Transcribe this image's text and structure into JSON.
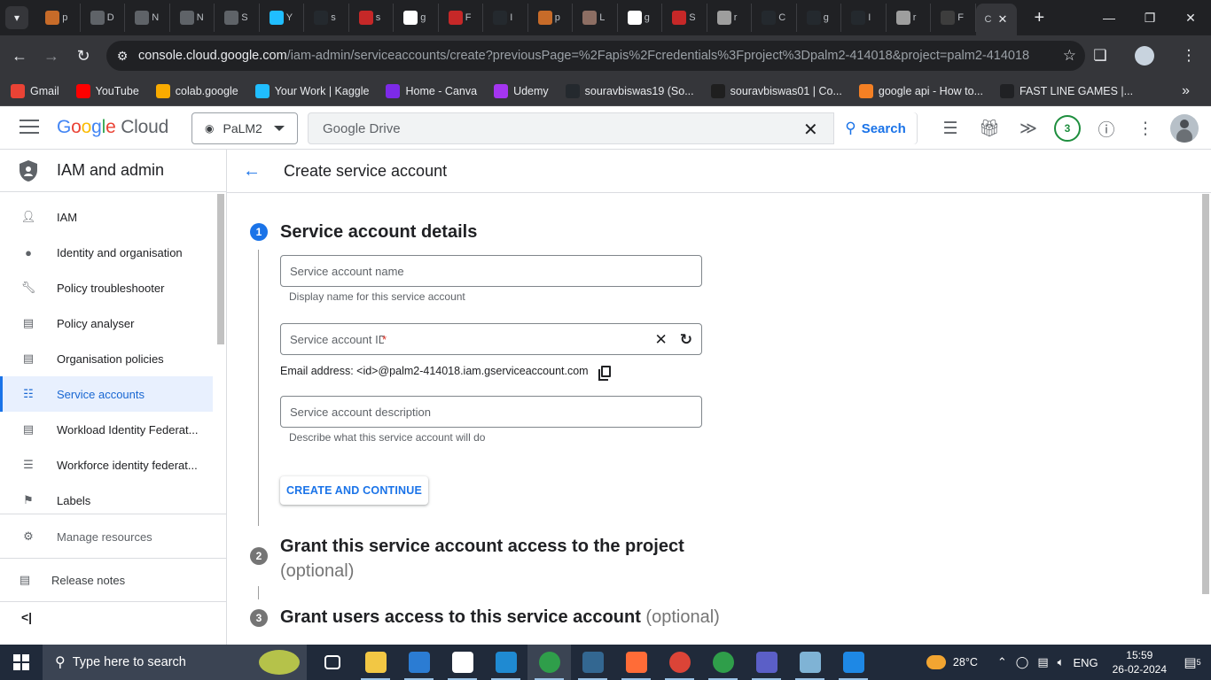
{
  "browser": {
    "tabs": [
      {
        "icon": "ai-icon",
        "label": "p",
        "color": "#c76b29"
      },
      {
        "icon": "doc-icon",
        "label": "D",
        "color": "#5f6368"
      },
      {
        "icon": "doc-icon",
        "label": "N",
        "color": "#5f6368"
      },
      {
        "icon": "doc-icon",
        "label": "N",
        "color": "#5f6368"
      },
      {
        "icon": "doc-icon",
        "label": "S",
        "color": "#5f6368"
      },
      {
        "icon": "kaggle-icon",
        "label": "Y",
        "color": "#20beff"
      },
      {
        "icon": "github-icon",
        "label": "s",
        "color": "#24292e"
      },
      {
        "icon": "crown-icon",
        "label": "s",
        "color": "#c62828"
      },
      {
        "icon": "google-icon",
        "label": "g",
        "color": "#ffffff"
      },
      {
        "icon": "crown-icon",
        "label": "F",
        "color": "#c62828"
      },
      {
        "icon": "github-icon",
        "label": "I",
        "color": "#24292e"
      },
      {
        "icon": "ai-icon",
        "label": "p",
        "color": "#c76b29"
      },
      {
        "icon": "llama-icon",
        "label": "L",
        "color": "#8d6e63"
      },
      {
        "icon": "google-icon",
        "label": "g",
        "color": "#ffffff"
      },
      {
        "icon": "crown-icon",
        "label": "S",
        "color": "#c62828"
      },
      {
        "icon": "crown-icon",
        "label": "r",
        "color": "#9e9e9e"
      },
      {
        "icon": "github-icon",
        "label": "C",
        "color": "#24292e"
      },
      {
        "icon": "github-icon",
        "label": "g",
        "color": "#24292e"
      },
      {
        "icon": "github-icon",
        "label": "I",
        "color": "#24292e"
      },
      {
        "icon": "crown-icon",
        "label": "r",
        "color": "#9e9e9e"
      },
      {
        "icon": "a-icon",
        "label": "F",
        "color": "#3d3d3d"
      }
    ],
    "active_tab": {
      "label": "C"
    },
    "url_host": "console.cloud.google.com",
    "url_path": "/iam-admin/serviceaccounts/create?previousPage=%2Fapis%2Fcredentials%3Fproject%3Dpalm2-414018&project=palm2-414018",
    "bookmarks": [
      {
        "label": "Gmail",
        "icon": "gmail-icon",
        "color": "#ea4335"
      },
      {
        "label": "YouTube",
        "icon": "youtube-icon",
        "color": "#ff0000"
      },
      {
        "label": "colab.google",
        "icon": "colab-icon",
        "color": "#f9ab00"
      },
      {
        "label": "Your Work | Kaggle",
        "icon": "kaggle-icon",
        "color": "#20beff"
      },
      {
        "label": "Home - Canva",
        "icon": "canva-icon",
        "color": "#7d2ae8"
      },
      {
        "label": "Udemy",
        "icon": "udemy-icon",
        "color": "#a435f0"
      },
      {
        "label": "souravbiswas19 (So...",
        "icon": "github-icon",
        "color": "#24292e"
      },
      {
        "label": "souravbiswas01 | Co...",
        "icon": "cc-icon",
        "color": "#1f1f1f"
      },
      {
        "label": "google api - How to...",
        "icon": "stackoverflow-icon",
        "color": "#f48024"
      },
      {
        "label": "FAST LINE GAMES |...",
        "icon": "game-icon",
        "color": "#202124"
      }
    ]
  },
  "header": {
    "logo_google": "Google",
    "logo_cloud": "Cloud",
    "project": "PaLM2",
    "search_value": "Google Drive",
    "search_label": "Search",
    "notifications_count": "3"
  },
  "sidebar": {
    "title": "IAM and admin",
    "items": [
      {
        "label": "IAM",
        "icon": "person-add-icon"
      },
      {
        "label": "Identity and organisation",
        "icon": "account-circle-icon"
      },
      {
        "label": "Policy troubleshooter",
        "icon": "wrench-icon"
      },
      {
        "label": "Policy analyser",
        "icon": "policy-icon"
      },
      {
        "label": "Organisation policies",
        "icon": "article-icon"
      },
      {
        "label": "Service accounts",
        "icon": "service-account-icon"
      },
      {
        "label": "Workload Identity Federat...",
        "icon": "id-card-icon"
      },
      {
        "label": "Workforce identity federat...",
        "icon": "list-icon"
      },
      {
        "label": "Labels",
        "icon": "label-icon"
      }
    ],
    "active_index": 5,
    "manage_resources": "Manage resources",
    "release_notes": "Release notes"
  },
  "main": {
    "page_title": "Create service account",
    "step1": {
      "num": "1",
      "title": "Service account details"
    },
    "name_placeholder": "Service account name",
    "name_hint": "Display name for this service account",
    "id_placeholder": "Service account ID",
    "id_required": "*",
    "email_text": "Email address: <id>@palm2-414018.iam.gserviceaccount.com",
    "desc_placeholder": "Service account description",
    "desc_hint": "Describe what this service account will do",
    "create_button": "CREATE AND CONTINUE",
    "step2": {
      "num": "2",
      "title": "Grant this service account access to the project",
      "optional": "(optional)"
    },
    "step3": {
      "num": "3",
      "title": "Grant users access to this service account",
      "optional": "(optional)"
    }
  },
  "taskbar": {
    "search_placeholder": "Type here to search",
    "apps": [
      {
        "icon": "task-view-icon",
        "color": "#202a3a"
      },
      {
        "icon": "file-explorer-icon",
        "color": "#f2c744"
      },
      {
        "icon": "store-icon",
        "color": "#2b7cd3"
      },
      {
        "icon": "slack-icon",
        "color": "#ffffff"
      },
      {
        "icon": "vscode-icon",
        "color": "#1f8ad2"
      },
      {
        "icon": "chrome-icon",
        "color": "#2f9e4a"
      },
      {
        "icon": "postgres-icon",
        "color": "#336791"
      },
      {
        "icon": "postman-icon",
        "color": "#ff6c37"
      },
      {
        "icon": "chrome-icon",
        "color": "#db4437"
      },
      {
        "icon": "chrome-icon",
        "color": "#2f9e4a"
      },
      {
        "icon": "teams-icon",
        "color": "#5b5fc7"
      },
      {
        "icon": "notepad-icon",
        "color": "#7fb3d5"
      },
      {
        "icon": "photos-icon",
        "color": "#1e88e5"
      }
    ],
    "temperature": "28°C",
    "language": "ENG",
    "time": "15:59",
    "date": "26-02-2024",
    "notification_count": "5"
  }
}
